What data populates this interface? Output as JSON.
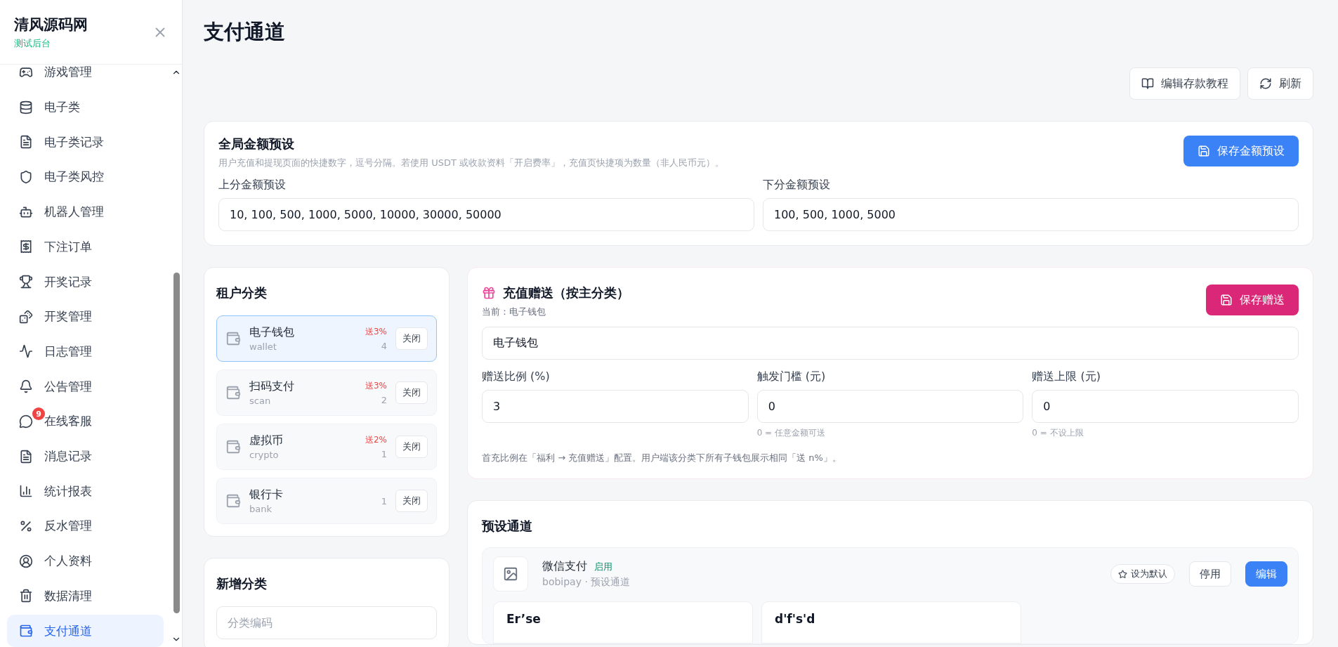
{
  "brand": {
    "title": "清风源码网",
    "subtitle": "测试后台"
  },
  "sidebar": {
    "items": [
      {
        "label": "游戏管理",
        "selected": false
      },
      {
        "label": "电子类",
        "selected": false
      },
      {
        "label": "电子类记录",
        "selected": false
      },
      {
        "label": "电子类风控",
        "selected": false
      },
      {
        "label": "机器人管理",
        "selected": false
      },
      {
        "label": "下注订单",
        "selected": false
      },
      {
        "label": "开奖记录",
        "selected": false
      },
      {
        "label": "开奖管理",
        "selected": false
      },
      {
        "label": "日志管理",
        "selected": false
      },
      {
        "label": "公告管理",
        "selected": false
      },
      {
        "label": "在线客服",
        "selected": false,
        "badge": "9"
      },
      {
        "label": "消息记录",
        "selected": false
      },
      {
        "label": "统计报表",
        "selected": false
      },
      {
        "label": "反水管理",
        "selected": false
      },
      {
        "label": "个人资料",
        "selected": false
      },
      {
        "label": "数据清理",
        "selected": false
      },
      {
        "label": "支付通道",
        "selected": true
      }
    ]
  },
  "page": {
    "title": "支付通道",
    "actions": [
      {
        "kind": "tutorial",
        "label": "编辑存款教程"
      },
      {
        "kind": "refresh",
        "label": "刷新"
      }
    ]
  },
  "amount_presets": {
    "title": "全局金额预设",
    "description": "用户充值和提现页面的快捷数字，逗号分隔。若使用 USDT 或收款资料「开启费率」，充值页快捷项为数量（非人民币元）。",
    "save_button": "保存金额预设",
    "fields": [
      {
        "label": "上分金额预设",
        "value": "10, 100, 500, 1000, 5000, 10000, 30000, 50000"
      },
      {
        "label": "下分金额预设",
        "value": "100, 500, 1000, 5000"
      }
    ]
  },
  "tenant_categories": {
    "title": "租户分类",
    "items": [
      {
        "name": "电子钱包",
        "code": "wallet",
        "bonus": "送3%",
        "count": "4",
        "action": "关闭",
        "selected": true
      },
      {
        "name": "扫码支付",
        "code": "scan",
        "bonus": "送3%",
        "count": "2",
        "action": "关闭",
        "selected": false
      },
      {
        "name": "虚拟币",
        "code": "crypto",
        "bonus": "送2%",
        "count": "1",
        "action": "关闭",
        "selected": false
      },
      {
        "name": "银行卡",
        "code": "bank",
        "count": "1",
        "action": "关闭",
        "selected": false
      }
    ]
  },
  "new_category": {
    "title": "新增分类",
    "placeholder": "分类编码"
  },
  "recharge_bonus": {
    "title": "充值赠送（按主分类）",
    "current": "当前：电子钱包",
    "save_button": "保存赠送",
    "category_value": "电子钱包",
    "fields": [
      {
        "label": "赠送比例 (%)",
        "value": "3"
      },
      {
        "label": "触发门槛 (元)",
        "value": "0",
        "hint": "0 = 任意金额可送"
      },
      {
        "label": "赠送上限 (元)",
        "value": "0",
        "hint": "0 = 不设上限"
      }
    ],
    "note": "首充比例在「福利 → 充值赠送」配置。用户端该分类下所有子钱包展示相同「送 n%」。"
  },
  "preset_channels": {
    "title": "预设通道",
    "channels": [
      {
        "name": "微信支付",
        "status": "启用",
        "enabled": true,
        "meta": "bobipay · 预设通道",
        "default_button": "设为默认",
        "disable_button": "停用",
        "edit_button": "编辑",
        "accounts": [
          {
            "name": "Er’se"
          },
          {
            "name": "d'f's'd"
          }
        ]
      }
    ]
  }
}
